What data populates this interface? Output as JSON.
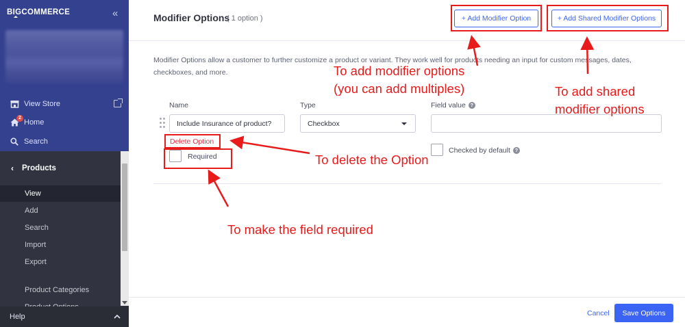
{
  "app": {
    "logo_text": "BIGCOMMERCE",
    "brand_color": "#34418f",
    "sidebar_color": "#313440",
    "accent_color": "#3c64f4",
    "annotation_color": "#e81a1a"
  },
  "sidebar": {
    "top_links": [
      {
        "label": "View Store",
        "icon": "storefront-icon"
      },
      {
        "label": "Home",
        "icon": "home-icon",
        "badge": "2"
      },
      {
        "label": "Search",
        "icon": "search-icon"
      }
    ],
    "section": {
      "label": "Products",
      "items": [
        {
          "label": "View",
          "active": true
        },
        {
          "label": "Add"
        },
        {
          "label": "Search"
        },
        {
          "label": "Import"
        },
        {
          "label": "Export"
        },
        {
          "label": "Product Categories"
        },
        {
          "label": "Product Options"
        }
      ]
    },
    "help_label": "Help"
  },
  "main": {
    "title": "Modifier Options",
    "count": "( 1 option )",
    "add_modifier_label": "+ Add Modifier Option",
    "add_shared_label": "+ Add Shared Modifier Options",
    "description": "Modifier Options allow a customer to further customize a product or variant. They work well for products needing an input for custom messages, dates, checkboxes, and more.",
    "columns": {
      "name": "Name",
      "type": "Type",
      "field_value": "Field value"
    },
    "option": {
      "name_value": "Include Insurance of product?",
      "type_value": "Checkbox",
      "field_value": "",
      "delete_label": "Delete Option",
      "required_label": "Required",
      "checked_default_label": "Checked by default"
    },
    "footer": {
      "cancel_label": "Cancel",
      "save_label": "Save Options"
    }
  },
  "annotations": {
    "add_modifier": [
      "To add modifier options",
      "(you can add multiples)"
    ],
    "add_shared": [
      "To add shared",
      "modifier options"
    ],
    "delete": "To delete the Option",
    "required": "To make the field required"
  }
}
